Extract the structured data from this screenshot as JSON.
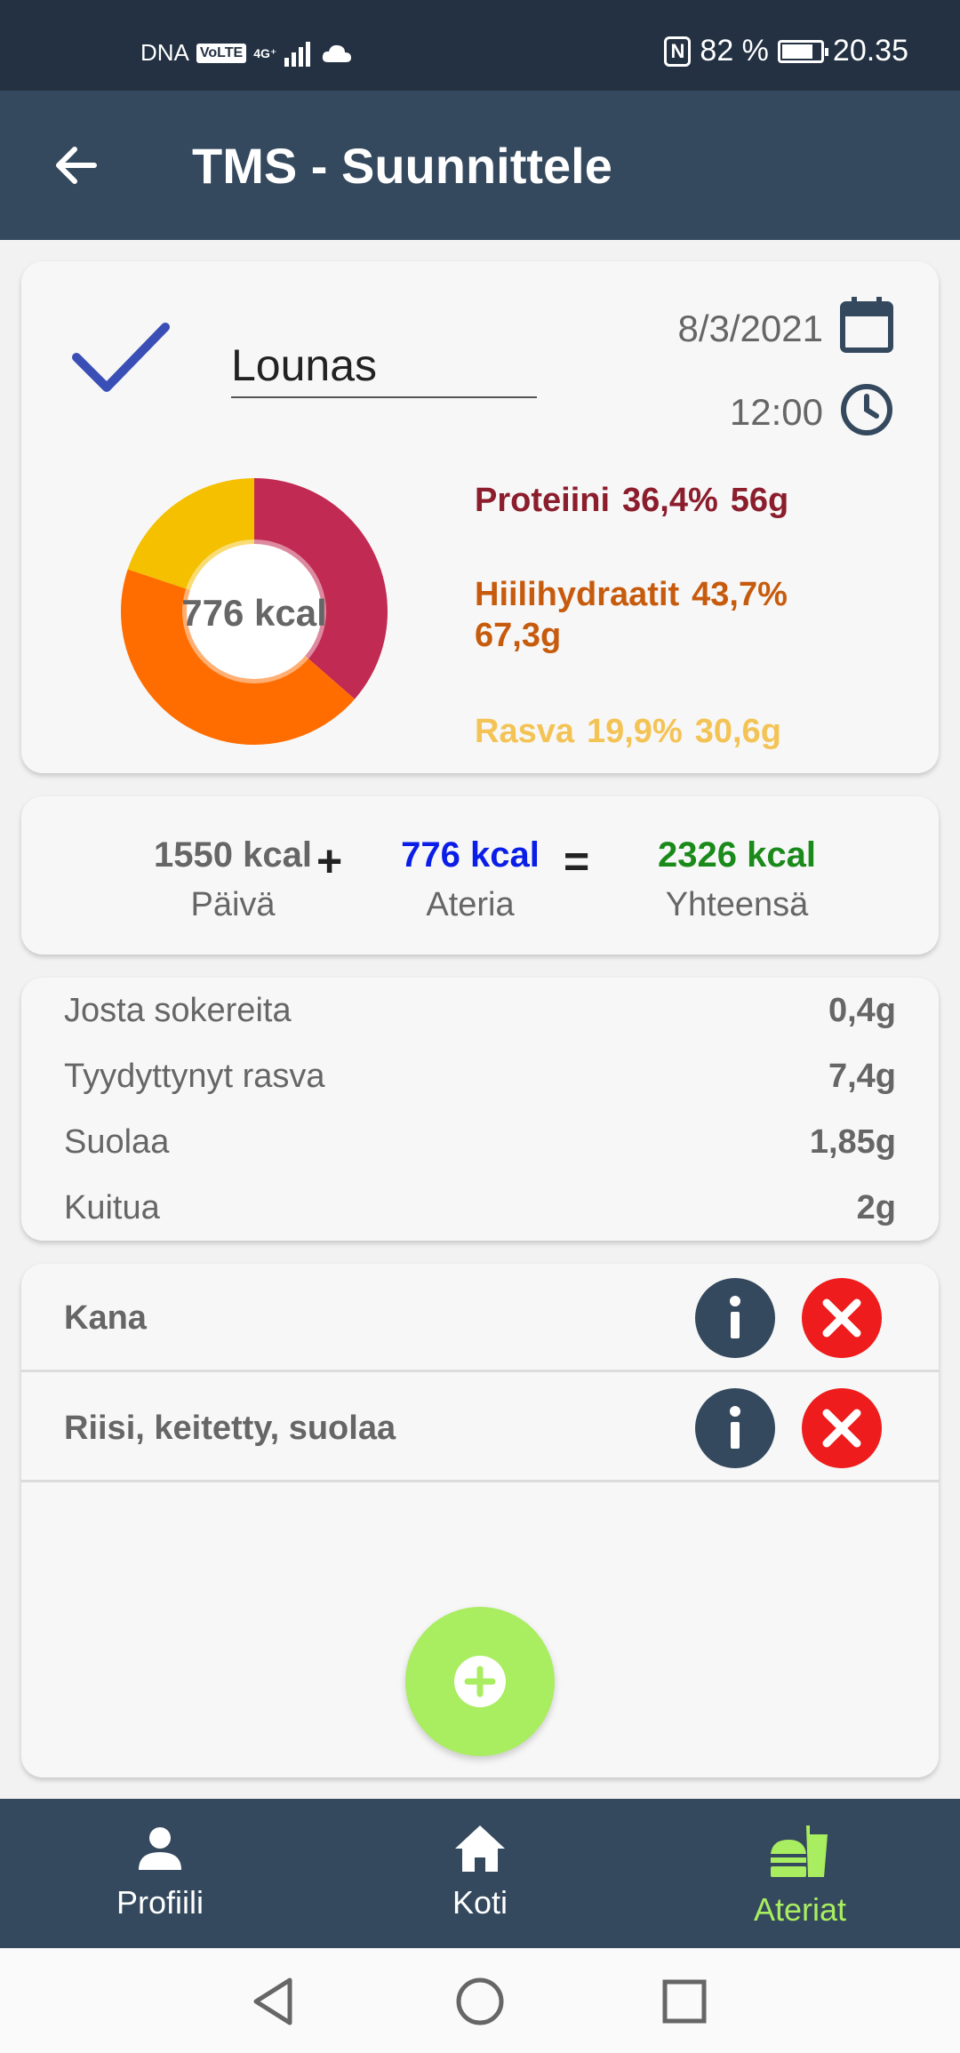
{
  "status_bar": {
    "carrier": "DNA",
    "volte": "VoLTE",
    "network": "4G⁺",
    "battery": "82 %",
    "battery_level": 82,
    "time": "20.35"
  },
  "app_bar": {
    "title": "TMS - Suunnittele"
  },
  "meal": {
    "name": "Lounas",
    "date": "8/3/2021",
    "time": "12:00",
    "kcal_label": "776 kcal",
    "macros": [
      {
        "name": "Proteiini",
        "percent": "36,4%",
        "grams": "56g",
        "share": 36.4,
        "color": "#c12a52"
      },
      {
        "name": "Hiilihydraatit",
        "percent": "43,7%",
        "grams": "67,3g",
        "share": 43.7,
        "color": "#ff6d00"
      },
      {
        "name": "Rasva",
        "percent": "19,9%",
        "grams": "30,6g",
        "share": 19.9,
        "color": "#f4c000"
      }
    ]
  },
  "totals": {
    "day_value": "1550 kcal",
    "day_label": "Päivä",
    "plus": "+",
    "meal_value": "776 kcal",
    "meal_label": "Ateria",
    "equals": "=",
    "total_value": "2326 kcal",
    "total_label": "Yhteensä",
    "colors": {
      "day": "#666666",
      "meal": "#0a1ee8",
      "total": "#1a8a1a"
    }
  },
  "nutrients": [
    {
      "name": "Josta sokereita",
      "value": "0,4g"
    },
    {
      "name": "Tyydyttynyt rasva",
      "value": "7,4g"
    },
    {
      "name": "Suolaa",
      "value": "1,85g"
    },
    {
      "name": "Kuitua",
      "value": "2g"
    }
  ],
  "foods": [
    {
      "name": "Kana"
    },
    {
      "name": "Riisi, keitetty, suolaa"
    }
  ],
  "bottom_nav": {
    "items": [
      {
        "label": "Profiili",
        "icon": "person-icon"
      },
      {
        "label": "Koti",
        "icon": "home-icon"
      },
      {
        "label": "Ateriat",
        "icon": "fastfood-icon",
        "active": true
      }
    ],
    "active_color": "#a9ed60"
  },
  "system_nav": [
    "back",
    "home",
    "recents"
  ]
}
